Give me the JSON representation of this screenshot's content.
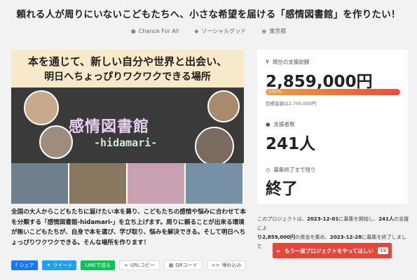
{
  "page_title": "頼れる人が周りにいないこどもたちへ、小さな希望を届ける「感情図書館」を作りたい！",
  "meta": {
    "owner": "Chance For All",
    "category": "ソーシャルグッド",
    "location": "東京都"
  },
  "hero": {
    "line1": "本を通じて、新しい自分や世界と出会い、",
    "line2": "明日へちょっぴりワクワクできる場所",
    "board_title": "感情図書館",
    "board_sub": "-hidamari-"
  },
  "description": "全国の大人からこどもたちに届けたい本を募り、こどもたちの感情や悩みに合わせて本を分類する「感情図書館-hidamari-」を立ち上げます。周りに頼ることが出来る環境が無いこどもたちが、自身で本を選び、学び取り、悩みを解決できる。そして明日へちょっぴりワクワクできる。そんな場所を作ります！",
  "share": {
    "facebook": "シェア",
    "twitter": "ツイート",
    "line": "LINEで送る",
    "url_copy": "URLコピー",
    "qr": "QRコード",
    "embed": "埋め込み"
  },
  "stats": {
    "total_label": "現在の支援総額",
    "total_amount": "2,859,000円",
    "progress_text": "105%",
    "progress_percent": 105,
    "goal_text": "目標金額は2,700,000円",
    "supporters_label": "支援者数",
    "supporters": "241人",
    "remaining_label": "募集終了まで残り",
    "remaining": "終了"
  },
  "summary": {
    "p1": "このプロジェクトは、",
    "start": "2023-12-01",
    "p2": "に募集を開始し、",
    "count": "241人",
    "p3": "の支援によ",
    "amount": "り2,859,000円",
    "p4": "の資金を集め、",
    "end": "2023-12-28",
    "p5": "に募集を終了しました"
  },
  "cta": {
    "label": "もう一度プロジェクトをやってほしい",
    "badge": "15"
  },
  "colors": {
    "accent": "#e8453a",
    "progress_start": "#f0a13a",
    "progress_end": "#ef4b3a"
  }
}
